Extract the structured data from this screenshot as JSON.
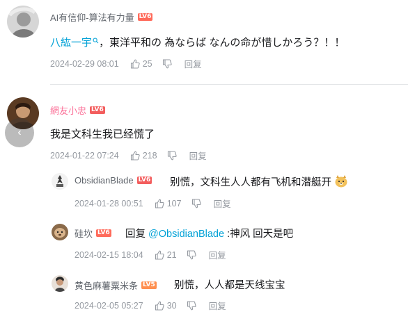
{
  "colors": {
    "link": "#00a1d6",
    "meta": "#9499a0",
    "username_vip": "#fb7299"
  },
  "comments": [
    {
      "user": "AI有信仰-算法有力量",
      "level": "LV6",
      "text_link": "八紘一宇",
      "text_rest": "，東洋平和の 為ならば なんの命が惜しかろう？！！",
      "date": "2024-02-29 08:01",
      "likes": "25",
      "reply_label": "回复"
    },
    {
      "user": "網友小忠",
      "level": "LV6",
      "text": "我是文科生我已经慌了",
      "date": "2024-01-22 07:24",
      "likes": "218",
      "reply_label": "回复"
    }
  ],
  "replies": [
    {
      "user": "ObsidianBlade",
      "level": "LV6",
      "text": "别慌，文科生人人都有飞机和潜艇开",
      "date": "2024-01-28 00:51",
      "likes": "107",
      "reply_label": "回复"
    },
    {
      "user": "硅坎",
      "level": "LV6",
      "reply_prefix": "回复",
      "mention": "@ObsidianBlade",
      "text": ":神风 回天是吧",
      "date": "2024-02-15 18:04",
      "likes": "21",
      "reply_label": "回复"
    },
    {
      "user": "黄色麻薯粟米条",
      "level": "LV5",
      "text": "别慌，人人都是天线宝宝",
      "date": "2024-02-05 05:27",
      "likes": "30",
      "reply_label": "回复"
    }
  ]
}
